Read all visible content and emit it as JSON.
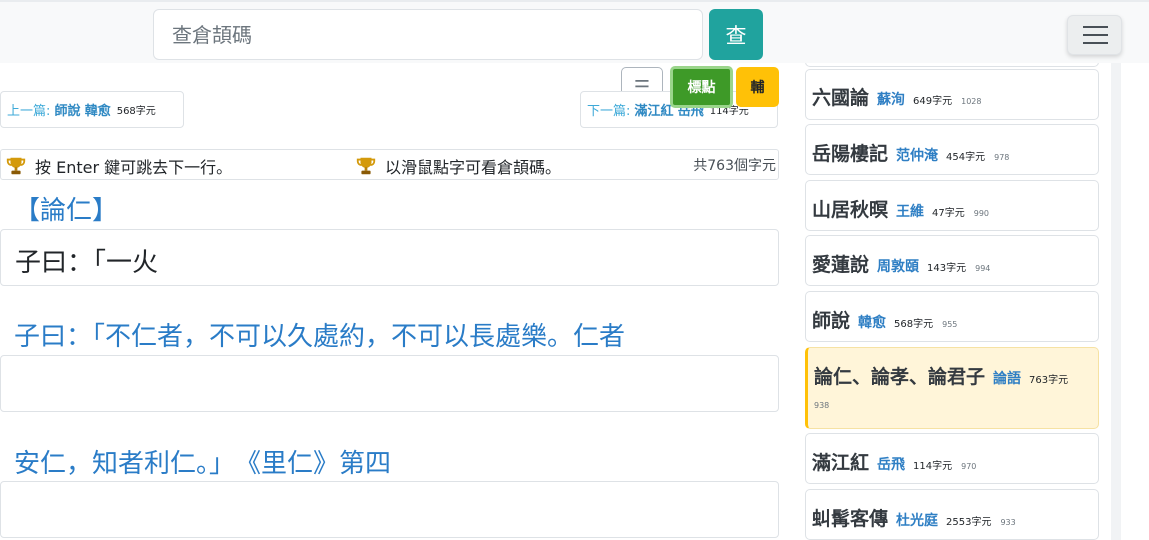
{
  "search": {
    "placeholder": "查倉頡碼",
    "button_label": "查"
  },
  "toolbar": {
    "list_label": "☰",
    "punct_label": "標點",
    "aux_label": "輔"
  },
  "nav": {
    "prev": {
      "label": "上一篇:",
      "title": "師說",
      "author": "韓愈",
      "count": "568字元"
    },
    "next": {
      "label": "下一篇:",
      "title": "滿江紅",
      "author": "岳飛",
      "count": "114字元"
    }
  },
  "hints": {
    "enter": "按 Enter 鍵可跳去下一行。",
    "mouse": "以滑鼠點字可看倉頡碼。",
    "total": "共763個字元"
  },
  "text": {
    "section_title": "【論仁】",
    "typed": "子曰：「一火",
    "lines": [
      "子曰：「不仁者，不可以久處約，不可以長處樂。仁者",
      "安仁，知者利仁。」　《里仁》第四"
    ]
  },
  "sidebar": {
    "items": [
      {
        "title": "六國論",
        "author": "蘇洵",
        "chars": "649字元",
        "id": "1028"
      },
      {
        "title": "岳陽樓記",
        "author": "范仲淹",
        "chars": "454字元",
        "id": "978"
      },
      {
        "title": "山居秋暝",
        "author": "王維",
        "chars": "47字元",
        "id": "990"
      },
      {
        "title": "愛蓮說",
        "author": "周敦頤",
        "chars": "143字元",
        "id": "994"
      },
      {
        "title": "師說",
        "author": "韓愈",
        "chars": "568字元",
        "id": "955"
      },
      {
        "title": "論仁、論孝、論君子",
        "author": "論語",
        "chars": "763字元",
        "id": "938"
      },
      {
        "title": "滿江紅",
        "author": "岳飛",
        "chars": "114字元",
        "id": "970"
      },
      {
        "title": "虯髯客傳",
        "author": "杜光庭",
        "chars": "2553字元",
        "id": "933"
      }
    ]
  },
  "colors": {
    "accent_teal": "#20a39e",
    "punct_green": "#3e9a28",
    "aux_yellow": "#ffc107",
    "link_blue": "#2a7cc7"
  }
}
